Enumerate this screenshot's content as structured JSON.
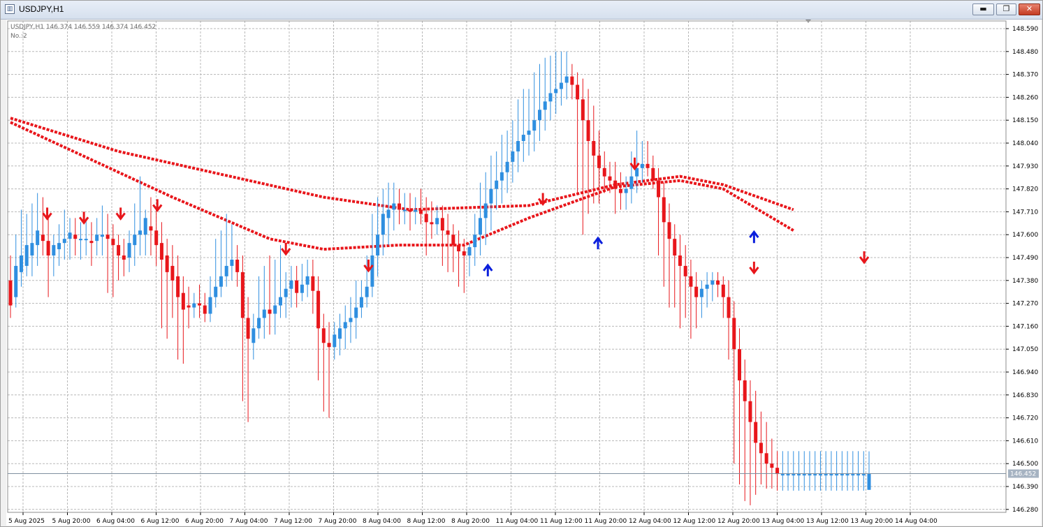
{
  "window": {
    "title": "USDJPY,H1"
  },
  "controls": {
    "minimize": "▬",
    "restore": "❐",
    "close": "✕"
  },
  "info": {
    "line1": "USDJPY,H1  146.374 146.559 146.374 146.452",
    "line2": "No.:2"
  },
  "colors": {
    "bull": "#2f8fe0",
    "bear": "#e8161b",
    "grid": "#b8b8b8",
    "axis_text": "#000000",
    "price_line": "#7f8fa0",
    "arrow_up": "#0b1fdc",
    "arrow_down": "#e8161b"
  },
  "chart_data": {
    "type": "candlestick",
    "y_ticks": [
      "148.590",
      "148.480",
      "148.370",
      "148.260",
      "148.150",
      "148.040",
      "147.930",
      "147.820",
      "147.710",
      "147.600",
      "147.490",
      "147.380",
      "147.270",
      "147.160",
      "147.050",
      "146.940",
      "146.830",
      "146.720",
      "146.610",
      "146.500",
      "146.390",
      "146.280"
    ],
    "ylim": [
      146.28,
      148.59
    ],
    "x_labels": [
      "5 Aug 2025",
      "5 Aug 20:00",
      "6 Aug 04:00",
      "6 Aug 12:00",
      "6 Aug 20:00",
      "7 Aug 04:00",
      "7 Aug 12:00",
      "7 Aug 20:00",
      "8 Aug 04:00",
      "8 Aug 12:00",
      "8 Aug 20:00",
      "11 Aug 04:00",
      "11 Aug 12:00",
      "11 Aug 20:00",
      "12 Aug 04:00",
      "12 Aug 12:00",
      "12 Aug 20:00",
      "13 Aug 04:00",
      "13 Aug 12:00",
      "13 Aug 20:00",
      "14 Aug 04:00"
    ],
    "current_price": "146.452",
    "bar_count": 160,
    "ohlc": [
      [
        147.38,
        147.5,
        147.2,
        147.26
      ],
      [
        147.3,
        147.6,
        147.25,
        147.45
      ],
      [
        147.42,
        147.72,
        147.35,
        147.5
      ],
      [
        147.45,
        147.7,
        147.4,
        147.55
      ],
      [
        147.5,
        147.75,
        147.4,
        147.56
      ],
      [
        147.55,
        147.8,
        147.45,
        147.62
      ],
      [
        147.6,
        147.78,
        147.5,
        147.57
      ],
      [
        147.57,
        147.68,
        147.3,
        147.5
      ],
      [
        147.5,
        147.6,
        147.4,
        147.55
      ],
      [
        147.53,
        147.65,
        147.45,
        147.56
      ],
      [
        147.56,
        147.72,
        147.48,
        147.58
      ],
      [
        147.58,
        147.68,
        147.48,
        147.61
      ],
      [
        147.6,
        147.68,
        147.5,
        147.58
      ],
      [
        147.58,
        147.66,
        147.48,
        147.58
      ],
      [
        147.58,
        147.68,
        147.5,
        147.58
      ],
      [
        147.57,
        147.66,
        147.45,
        147.56
      ],
      [
        147.57,
        147.68,
        147.5,
        147.6
      ],
      [
        147.59,
        147.74,
        147.5,
        147.6
      ],
      [
        147.6,
        147.7,
        147.32,
        147.58
      ],
      [
        147.58,
        147.65,
        147.3,
        147.55
      ],
      [
        147.55,
        147.6,
        147.38,
        147.5
      ],
      [
        147.5,
        147.58,
        147.4,
        147.48
      ],
      [
        147.49,
        147.62,
        147.42,
        147.56
      ],
      [
        147.55,
        147.75,
        147.45,
        147.6
      ],
      [
        147.6,
        147.88,
        147.5,
        147.62
      ],
      [
        147.6,
        147.72,
        147.5,
        147.68
      ],
      [
        147.64,
        147.78,
        147.5,
        147.62
      ],
      [
        147.62,
        147.72,
        147.45,
        147.55
      ],
      [
        147.56,
        147.66,
        147.15,
        147.48
      ],
      [
        147.5,
        147.58,
        147.1,
        147.42
      ],
      [
        147.45,
        147.55,
        147.2,
        147.38
      ],
      [
        147.4,
        147.5,
        147.0,
        147.3
      ],
      [
        147.32,
        147.4,
        146.98,
        147.24
      ],
      [
        147.26,
        147.35,
        147.15,
        147.25
      ],
      [
        147.25,
        147.32,
        147.2,
        147.27
      ],
      [
        147.27,
        147.36,
        147.2,
        147.26
      ],
      [
        147.26,
        147.32,
        147.18,
        147.22
      ],
      [
        147.22,
        147.4,
        147.18,
        147.3
      ],
      [
        147.3,
        147.58,
        147.25,
        147.35
      ],
      [
        147.35,
        147.62,
        147.3,
        147.4
      ],
      [
        147.4,
        147.7,
        147.35,
        147.45
      ],
      [
        147.45,
        147.65,
        147.38,
        147.48
      ],
      [
        147.48,
        147.55,
        147.35,
        147.42
      ],
      [
        147.42,
        147.5,
        146.8,
        147.2
      ],
      [
        147.2,
        147.3,
        146.7,
        147.1
      ],
      [
        147.08,
        147.22,
        147.0,
        147.15
      ],
      [
        147.15,
        147.4,
        147.1,
        147.2
      ],
      [
        147.2,
        147.45,
        147.1,
        147.24
      ],
      [
        147.24,
        147.5,
        147.12,
        147.22
      ],
      [
        147.22,
        147.48,
        147.12,
        147.26
      ],
      [
        147.26,
        147.55,
        147.2,
        147.3
      ],
      [
        147.3,
        147.42,
        147.2,
        147.34
      ],
      [
        147.34,
        147.45,
        147.25,
        147.38
      ],
      [
        147.38,
        147.45,
        147.25,
        147.32
      ],
      [
        147.32,
        147.46,
        147.28,
        147.36
      ],
      [
        147.36,
        147.48,
        147.3,
        147.4
      ],
      [
        147.4,
        147.48,
        147.22,
        147.33
      ],
      [
        147.33,
        147.4,
        146.9,
        147.15
      ],
      [
        147.15,
        147.22,
        146.75,
        147.08
      ],
      [
        147.08,
        147.18,
        146.72,
        147.06
      ],
      [
        147.06,
        147.18,
        147.0,
        147.12
      ],
      [
        147.1,
        147.22,
        147.02,
        147.15
      ],
      [
        147.15,
        147.26,
        147.05,
        147.18
      ],
      [
        147.18,
        147.3,
        147.08,
        147.2
      ],
      [
        147.2,
        147.38,
        147.1,
        147.25
      ],
      [
        147.25,
        147.38,
        147.2,
        147.3
      ],
      [
        147.3,
        147.5,
        147.25,
        147.35
      ],
      [
        147.35,
        147.7,
        147.3,
        147.5
      ],
      [
        147.5,
        147.78,
        147.4,
        147.6
      ],
      [
        147.6,
        147.82,
        147.5,
        147.7
      ],
      [
        147.68,
        147.85,
        147.55,
        147.72
      ],
      [
        147.72,
        147.85,
        147.62,
        147.75
      ],
      [
        147.75,
        147.82,
        147.65,
        147.72
      ],
      [
        147.72,
        147.8,
        147.65,
        147.72
      ],
      [
        147.72,
        147.8,
        147.62,
        147.71
      ],
      [
        147.71,
        147.78,
        147.65,
        147.72
      ],
      [
        147.72,
        147.82,
        147.65,
        147.7
      ],
      [
        147.7,
        147.78,
        147.5,
        147.66
      ],
      [
        147.66,
        147.76,
        147.58,
        147.65
      ],
      [
        147.65,
        147.74,
        147.6,
        147.68
      ],
      [
        147.68,
        147.74,
        147.45,
        147.62
      ],
      [
        147.62,
        147.7,
        147.42,
        147.6
      ],
      [
        147.6,
        147.65,
        147.42,
        147.55
      ],
      [
        147.55,
        147.62,
        147.35,
        147.52
      ],
      [
        147.52,
        147.58,
        147.32,
        147.5
      ],
      [
        147.5,
        147.56,
        147.4,
        147.54
      ],
      [
        147.54,
        147.7,
        147.45,
        147.6
      ],
      [
        147.6,
        147.85,
        147.5,
        147.68
      ],
      [
        147.68,
        147.9,
        147.55,
        147.75
      ],
      [
        147.75,
        147.98,
        147.62,
        147.82
      ],
      [
        147.82,
        148.0,
        147.72,
        147.86
      ],
      [
        147.86,
        148.08,
        147.75,
        147.9
      ],
      [
        147.9,
        148.1,
        147.8,
        147.95
      ],
      [
        147.95,
        148.15,
        147.85,
        148.0
      ],
      [
        148.0,
        148.25,
        147.9,
        148.05
      ],
      [
        148.05,
        148.3,
        147.95,
        148.08
      ],
      [
        148.08,
        148.3,
        147.98,
        148.1
      ],
      [
        148.1,
        148.38,
        148.0,
        148.15
      ],
      [
        148.15,
        148.42,
        148.05,
        148.2
      ],
      [
        148.2,
        148.45,
        148.1,
        148.24
      ],
      [
        148.24,
        148.46,
        148.15,
        148.28
      ],
      [
        148.28,
        148.48,
        148.18,
        148.3
      ],
      [
        148.3,
        148.48,
        148.22,
        148.33
      ],
      [
        148.33,
        148.48,
        148.25,
        148.36
      ],
      [
        148.36,
        148.42,
        148.25,
        148.32
      ],
      [
        148.32,
        148.38,
        147.8,
        148.25
      ],
      [
        148.25,
        148.35,
        147.6,
        148.15
      ],
      [
        148.15,
        148.3,
        147.7,
        148.05
      ],
      [
        148.05,
        148.22,
        147.75,
        147.98
      ],
      [
        147.98,
        148.1,
        147.75,
        147.92
      ],
      [
        147.92,
        148.0,
        147.8,
        147.88
      ],
      [
        147.88,
        147.95,
        147.8,
        147.86
      ],
      [
        147.86,
        147.95,
        147.7,
        147.82
      ],
      [
        147.82,
        147.9,
        147.72,
        147.8
      ],
      [
        147.8,
        147.88,
        147.72,
        147.82
      ],
      [
        147.82,
        148.0,
        147.75,
        147.88
      ],
      [
        147.88,
        148.1,
        147.8,
        147.92
      ],
      [
        147.92,
        148.05,
        147.85,
        147.94
      ],
      [
        147.94,
        148.05,
        147.88,
        147.92
      ],
      [
        147.92,
        147.98,
        147.82,
        147.86
      ],
      [
        147.86,
        147.92,
        147.5,
        147.78
      ],
      [
        147.78,
        147.85,
        147.35,
        147.66
      ],
      [
        147.66,
        147.75,
        147.25,
        147.58
      ],
      [
        147.58,
        147.65,
        147.25,
        147.5
      ],
      [
        147.5,
        147.6,
        147.15,
        147.45
      ],
      [
        147.45,
        147.55,
        147.2,
        147.4
      ],
      [
        147.4,
        147.48,
        147.1,
        147.35
      ],
      [
        147.35,
        147.42,
        147.15,
        147.3
      ],
      [
        147.3,
        147.38,
        147.2,
        147.34
      ],
      [
        147.34,
        147.42,
        147.25,
        147.36
      ],
      [
        147.36,
        147.42,
        147.28,
        147.38
      ],
      [
        147.38,
        147.42,
        147.3,
        147.36
      ],
      [
        147.36,
        147.4,
        147.2,
        147.3
      ],
      [
        147.3,
        147.38,
        147.0,
        147.2
      ],
      [
        147.2,
        147.28,
        146.5,
        147.05
      ],
      [
        147.05,
        147.15,
        146.4,
        146.9
      ],
      [
        146.9,
        147.0,
        146.32,
        146.8
      ],
      [
        146.8,
        146.9,
        146.3,
        146.7
      ],
      [
        146.7,
        146.85,
        146.35,
        146.6
      ],
      [
        146.6,
        146.75,
        146.4,
        146.55
      ],
      [
        146.55,
        146.7,
        146.38,
        146.5
      ],
      [
        146.5,
        146.62,
        146.38,
        146.48
      ],
      [
        146.48,
        146.56,
        146.37,
        146.45
      ],
      [
        146.45,
        146.56,
        146.37,
        146.45
      ],
      [
        146.45,
        146.56,
        146.37,
        146.45
      ],
      [
        146.45,
        146.56,
        146.37,
        146.45
      ],
      [
        146.45,
        146.56,
        146.37,
        146.45
      ],
      [
        146.45,
        146.56,
        146.37,
        146.45
      ],
      [
        146.45,
        146.56,
        146.37,
        146.45
      ],
      [
        146.45,
        146.56,
        146.37,
        146.45
      ],
      [
        146.45,
        146.56,
        146.37,
        146.45
      ],
      [
        146.45,
        146.56,
        146.37,
        146.45
      ],
      [
        146.45,
        146.56,
        146.37,
        146.45
      ],
      [
        146.45,
        146.56,
        146.37,
        146.45
      ],
      [
        146.45,
        146.56,
        146.37,
        146.45
      ],
      [
        146.45,
        146.56,
        146.37,
        146.45
      ],
      [
        146.45,
        146.56,
        146.37,
        146.45
      ],
      [
        146.45,
        146.56,
        146.37,
        146.45
      ],
      [
        146.45,
        146.56,
        146.37,
        146.45
      ],
      [
        146.374,
        146.559,
        146.374,
        146.452
      ]
    ],
    "ma_fast": [
      [
        0,
        148.14
      ],
      [
        30,
        147.78
      ],
      [
        48,
        147.58
      ],
      [
        58,
        147.53
      ],
      [
        72,
        147.55
      ],
      [
        84,
        147.55
      ],
      [
        96,
        147.68
      ],
      [
        112,
        147.83
      ],
      [
        124,
        147.86
      ],
      [
        132,
        147.82
      ],
      [
        145,
        147.62
      ]
    ],
    "ma_slow": [
      [
        0,
        148.16
      ],
      [
        20,
        148.0
      ],
      [
        58,
        147.78
      ],
      [
        74,
        147.72
      ],
      [
        96,
        147.74
      ],
      [
        112,
        147.84
      ],
      [
        124,
        147.88
      ],
      [
        132,
        147.84
      ],
      [
        145,
        147.72
      ]
    ],
    "arrows_down": [
      [
        8,
        147.69
      ],
      [
        16,
        147.67
      ],
      [
        24,
        147.69
      ],
      [
        32,
        147.73
      ],
      [
        60,
        147.52
      ],
      [
        78,
        147.44
      ],
      [
        116,
        147.76
      ],
      [
        136,
        147.93
      ],
      [
        162,
        147.43
      ],
      [
        186,
        147.48
      ]
    ],
    "arrows_up": [
      [
        104,
        147.44
      ],
      [
        128,
        147.57
      ],
      [
        162,
        147.6
      ]
    ]
  }
}
